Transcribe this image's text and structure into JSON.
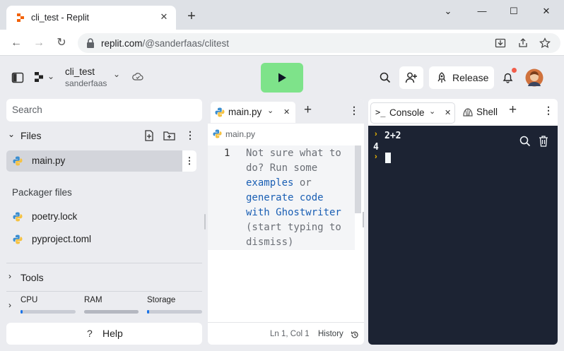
{
  "browser": {
    "tab_title": "cli_test - Replit",
    "url_host": "replit.com",
    "url_path": "/@sanderfaas/clitest"
  },
  "header": {
    "project_name": "cli_test",
    "owner": "sanderfaas",
    "release_label": "Release"
  },
  "sidebar": {
    "search_placeholder": "Search",
    "files_label": "Files",
    "files": [
      {
        "label": "main.py"
      }
    ],
    "packager_label": "Packager files",
    "packager_files": [
      {
        "label": "poetry.lock"
      },
      {
        "label": "pyproject.toml"
      }
    ],
    "tools_label": "Tools",
    "resources": [
      {
        "label": "CPU",
        "value": 0.04
      },
      {
        "label": "RAM",
        "value": 1.0
      },
      {
        "label": "Storage",
        "value": 0.04
      }
    ],
    "help_label": "Help"
  },
  "editor": {
    "tab_label": "main.py",
    "breadcrumb": "main.py",
    "line_number": "1",
    "hint": {
      "l1": "Not sure what to",
      "l2": "do? Run some",
      "l3_link": "examples",
      "l3_rest": " or",
      "l4_link": "generate code",
      "l5_link": "with Ghostwriter",
      "l6": "(start typing to",
      "l7": "dismiss)"
    },
    "cursor_pos": "Ln 1, Col 1",
    "history_label": "History"
  },
  "console": {
    "tab_label": "Console",
    "shell_label": "Shell",
    "lines": {
      "input": "2+2",
      "output": "4"
    }
  },
  "colors": {
    "run_button": "#7ee38a",
    "console_bg": "#1c2333",
    "accent": "#1a73e8",
    "prompt": "#f0b900"
  }
}
